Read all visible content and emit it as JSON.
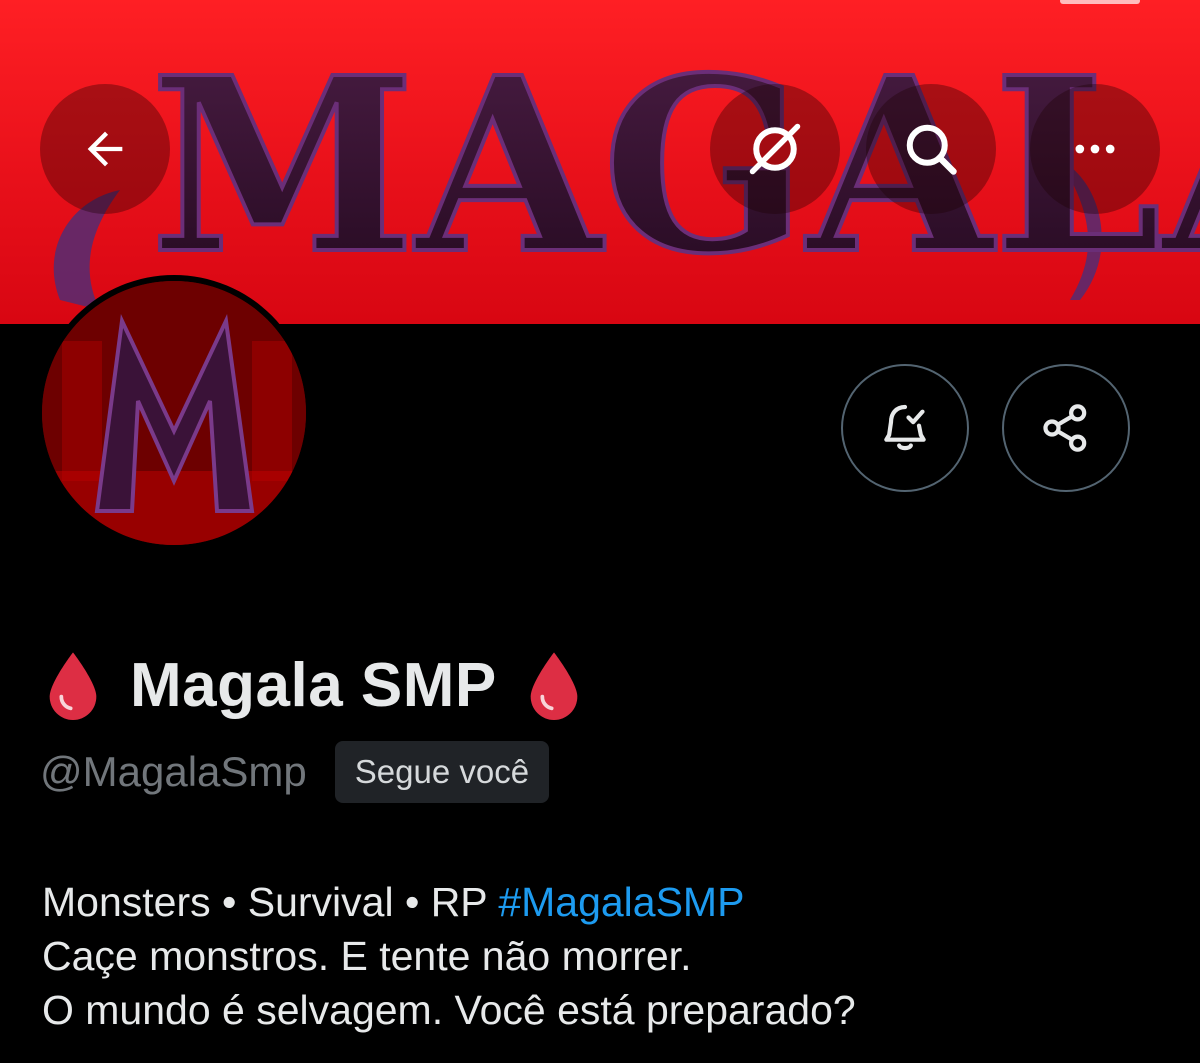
{
  "banner": {
    "logo_text": "MAGALA"
  },
  "header_actions": {
    "back_icon": "arrow-left-icon",
    "grok_icon": "grok-icon",
    "search_icon": "search-icon",
    "more_icon": "more-horizontal-icon"
  },
  "profile_actions": {
    "notify_icon": "bell-check-icon",
    "share_icon": "share-icon"
  },
  "profile": {
    "display_name": "Magala SMP",
    "name_emoji": "drop-of-blood",
    "handle": "@MagalaSmp",
    "follows_you_label": "Segue você",
    "bio": {
      "line1_text": "Monsters • Survival • RP ",
      "line1_hashtag": "#MagalaSMP",
      "line2": "Caçe monstros. E tente não morrer.",
      "line3": "O mundo é selvagem. Você está preparado?"
    }
  },
  "colors": {
    "banner_red": "#e8101a",
    "logo_purple": "#3a1530",
    "hashtag_blue": "#1d9bf0",
    "handle_gray": "#71767b",
    "blood_red": "#dd2e44"
  }
}
